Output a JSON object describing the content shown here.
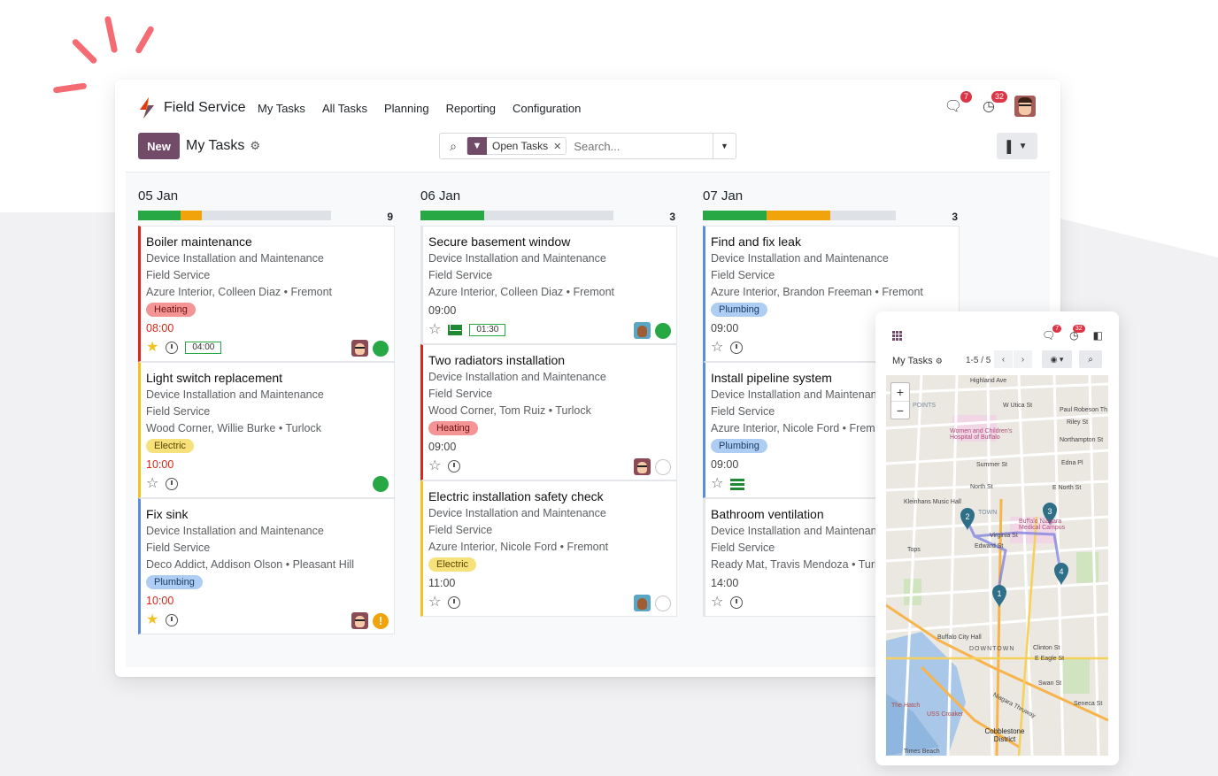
{
  "app": {
    "name": "Field Service",
    "menu": [
      "My Tasks",
      "All Tasks",
      "Planning",
      "Reporting",
      "Configuration"
    ],
    "messages_count": "7",
    "activities_count": "32"
  },
  "control": {
    "new_label": "New",
    "title": "My Tasks",
    "facet_label": "Open Tasks",
    "search_placeholder": "Search..."
  },
  "columns": [
    {
      "title": "05 Jan",
      "count": "9",
      "progress": {
        "green": 0.22,
        "orange": 0.11
      },
      "cards": [
        {
          "title": "Boiler maintenance",
          "project": "Device Installation and Maintenance",
          "service": "Field Service",
          "customer": "Azure Interior, Colleen Diaz • Fremont",
          "tag": "Heating",
          "tag_type": "heating",
          "time": "08:00",
          "late": true,
          "starred": true,
          "timer": "04:00",
          "border": "#d9281a",
          "avatar": "a1",
          "status": "green"
        },
        {
          "title": "Light switch replacement",
          "project": "Device Installation and Maintenance",
          "service": "Field Service",
          "customer": "Wood Corner, Willie Burke • Turlock",
          "tag": "Electric",
          "tag_type": "electric",
          "time": "10:00",
          "late": true,
          "starred": false,
          "timer": "",
          "border": "#f3c221",
          "avatar": "",
          "status": "green"
        },
        {
          "title": "Fix sink",
          "project": "Device Installation and Maintenance",
          "service": "Field Service",
          "customer": "Deco Addict, Addison Olson • Pleasant Hill",
          "tag": "Plumbing",
          "tag_type": "plumbing",
          "time": "10:00",
          "late": true,
          "starred": true,
          "timer": "",
          "border": "#5b8ed6",
          "avatar": "a1",
          "status": "warn"
        }
      ]
    },
    {
      "title": "06 Jan",
      "count": "3",
      "progress": {
        "green": 0.33,
        "orange": 0
      },
      "cards": [
        {
          "title": "Secure basement window",
          "project": "Device Installation and Maintenance",
          "service": "Field Service",
          "customer": "Azure Interior, Colleen Diaz • Fremont",
          "tag": "",
          "tag_type": "",
          "time": "09:00",
          "late": false,
          "starred": false,
          "timer": "01:30",
          "mail": true,
          "border": "#e4e6e9",
          "avatar": "a2",
          "status": "green"
        },
        {
          "title": "Two radiators installation",
          "project": "Device Installation and Maintenance",
          "service": "Field Service",
          "customer": "Wood Corner, Tom Ruiz • Turlock",
          "tag": "Heating",
          "tag_type": "heating",
          "time": "09:00",
          "late": false,
          "starred": false,
          "timer": "",
          "border": "#d9281a",
          "avatar": "a1",
          "status": "grey"
        },
        {
          "title": "Electric installation safety check",
          "project": "Device Installation and Maintenance",
          "service": "Field Service",
          "customer": "Azure Interior, Nicole Ford • Fremont",
          "tag": "Electric",
          "tag_type": "electric",
          "time": "11:00",
          "late": false,
          "starred": false,
          "timer": "",
          "border": "#f3c221",
          "avatar": "a2",
          "status": "grey"
        }
      ]
    },
    {
      "title": "07 Jan",
      "count": "3",
      "progress": {
        "green": 0.33,
        "orange": 0.33
      },
      "cards": [
        {
          "title": "Find and fix leak",
          "project": "Device Installation and Maintenance",
          "service": "Field Service",
          "customer": "Azure Interior, Brandon Freeman • Fremont",
          "tag": "Plumbing",
          "tag_type": "plumbing",
          "time": "09:00",
          "late": false,
          "starred": false,
          "timer": "",
          "border": "#5b8ed6",
          "avatar": "",
          "status": ""
        },
        {
          "title": "Install pipeline system",
          "project": "Device Installation and Maintenance",
          "service": "Field Service",
          "customer": "Azure Interior, Nicole Ford • Fremont",
          "tag": "Plumbing",
          "tag_type": "plumbing",
          "time": "09:00",
          "late": false,
          "starred": false,
          "timer": "",
          "phone": true,
          "border": "#5b8ed6",
          "avatar": "",
          "status": ""
        },
        {
          "title": "Bathroom ventilation",
          "project": "Device Installation and Maintenance",
          "service": "Field Service",
          "customer": "Ready Mat, Travis Mendoza • Turlock",
          "tag": "",
          "tag_type": "",
          "time": "14:00",
          "late": false,
          "starred": false,
          "timer": "",
          "border": "#e4e6e9",
          "avatar": "",
          "status": ""
        }
      ]
    }
  ],
  "mobile": {
    "title": "My Tasks",
    "pager": "1-5 / 5",
    "messages_count": "7",
    "activities_count": "32",
    "zoom_in": "+",
    "zoom_out": "−",
    "map_labels": [
      "Highland Ave",
      "W Utica St",
      "Paul Robeson Th",
      "Riley St",
      "POINTS",
      "Women and Children's Hospital of Buffalo",
      "Northampton St",
      "Summer St",
      "Edna Pl",
      "North St",
      "E North St",
      "Kleinhans Music Hall",
      "TOWN",
      "Buffalo Niagara Medical Campus",
      "Virginia St",
      "Edward St",
      "Tops",
      "Buffalo City Hall",
      "DOWNTOWN",
      "Clinton St",
      "E Eagle St",
      "Swan St",
      "Seneca St",
      "The Hatch",
      "USS Croaker",
      "Cobblestone District",
      "Niagara Thruway",
      "Times Beach"
    ],
    "pins": [
      "1",
      "2",
      "3",
      "4"
    ]
  }
}
